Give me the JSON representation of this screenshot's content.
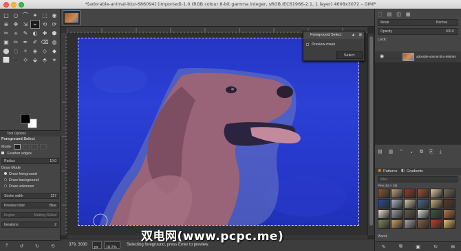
{
  "window": {
    "title": "*[adorable-animal-blur-686094] (imported)-1.0 (RGB colour 8-bit gamma integer, sRGB IEC61966-2.1, 1 layer) 4608x3072 – GIMP"
  },
  "toolbox": {
    "tool_icons": [
      "□",
      "○",
      "⌒",
      "✦",
      "⬚",
      "◉",
      "⊕",
      "✥",
      "⇲",
      "⌁",
      "⟲",
      "⟳",
      "✂",
      "⟡",
      "✎",
      "◐",
      "✚",
      "⬢",
      "▣",
      "✏",
      "✒",
      "✐",
      "⌫",
      "◍",
      "⬤",
      "◌",
      "✧",
      "◈",
      "◇",
      "◆",
      "⬜",
      "⬛",
      "⟐",
      "⬙",
      "⬘",
      "✶"
    ],
    "tab_label": "Tool Options",
    "tool_name": "Foreground Select",
    "mode_label": "Mode",
    "feather_label": "Feather edges",
    "radius_label": "Radius",
    "radius_value": "10.0",
    "draw_mode_label": "Draw Mode",
    "draw_modes": [
      "Draw foreground",
      "Draw background",
      "Draw unknown"
    ],
    "stroke_label": "Stroke width",
    "stroke_value": "227",
    "preview_label": "Preview color",
    "preview_value": "Blue",
    "engine_label": "Engine",
    "engine_value": "Matting Global",
    "iterations_label": "Iterations",
    "iterations_value": "2",
    "bottom_icons": [
      "⤒",
      "↺",
      "↻",
      "⟲"
    ]
  },
  "fs_dialog": {
    "title": "Foreground Select",
    "preview_mask_label": "Preview mask",
    "select_button": "Select"
  },
  "statusbar": {
    "coords": "379, 3030",
    "unit": "px",
    "zoom": "18.2%",
    "message": "Selecting foreground, press Enter to preview."
  },
  "dock": {
    "top_icons": [
      "⬚",
      "▤",
      "◫",
      "▦"
    ],
    "mode_label": "Mode",
    "mode_value": "Normal",
    "opacity_label": "Opacity",
    "opacity_value": "100.0",
    "lock_label": "Lock:",
    "layer_name": "adorable-animal-blur-686094",
    "layer_buttons": [
      "▤",
      "▥",
      "⌃",
      "⌄",
      "⧉",
      "⎘",
      "⤓"
    ],
    "patterns_tab": "Patterns",
    "gradients_tab": "Gradients",
    "filter_placeholder": "filter",
    "pattern_title": "Pine (64 × 38)",
    "pattern_name": "Wood,",
    "bottom_icons": [
      "✎",
      "⧉",
      "▣",
      "↻",
      "⊞"
    ]
  },
  "watermark": "双电网(www.pcpc.me)",
  "colors": {
    "accent_blue": "#2b3fd6",
    "dog_fur": "#9a6a7a"
  }
}
